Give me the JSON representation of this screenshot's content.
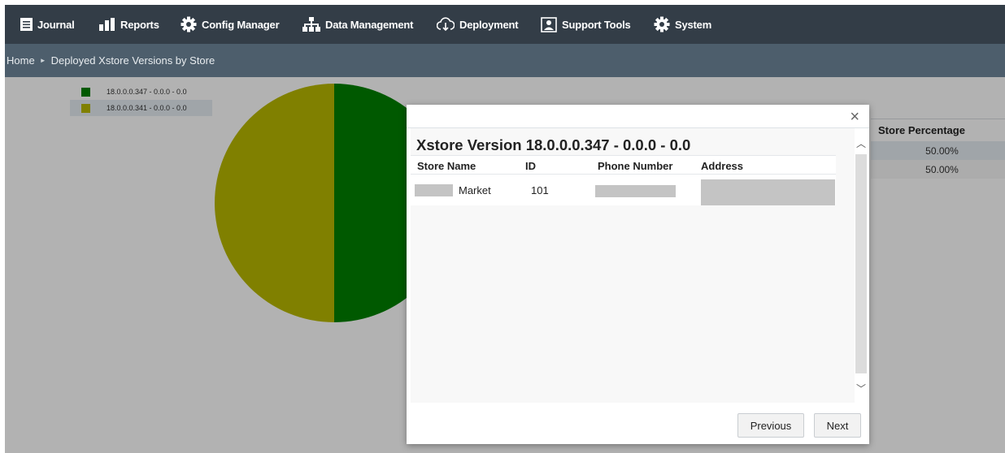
{
  "nav": {
    "items": [
      {
        "label": "Journal",
        "icon": "journal-icon"
      },
      {
        "label": "Reports",
        "icon": "bar-chart-icon"
      },
      {
        "label": "Config Manager",
        "icon": "gear-icon"
      },
      {
        "label": "Data Management",
        "icon": "hierarchy-icon"
      },
      {
        "label": "Deployment",
        "icon": "cloud-download-icon"
      },
      {
        "label": "Support Tools",
        "icon": "support-icon"
      },
      {
        "label": "System",
        "icon": "gear-icon"
      }
    ]
  },
  "breadcrumb": {
    "home": "Home",
    "current": "Deployed Xstore Versions by Store"
  },
  "chart_data": {
    "type": "pie",
    "categories": [
      "18.0.0.0.347 - 0.0.0 - 0.0",
      "18.0.0.0.341 - 0.0.0 - 0.0"
    ],
    "values": [
      50,
      50
    ],
    "colors": [
      "#008000",
      "#b8b800"
    ],
    "legend_position": "top-left"
  },
  "legend": {
    "items": [
      "18.0.0.0.347 - 0.0.0 - 0.0",
      "18.0.0.0.341 - 0.0.0 - 0.0"
    ]
  },
  "percentage_table": {
    "header": "Store Percentage",
    "rows": [
      "50.00%",
      "50.00%"
    ]
  },
  "modal": {
    "close": "×",
    "title": "Xstore Version 18.0.0.0.347 - 0.0.0 - 0.0",
    "columns": [
      "Store Name",
      "ID",
      "Phone Number",
      "Address"
    ],
    "rows": [
      {
        "store_name": "Market",
        "id": "101",
        "phone": "",
        "address": ""
      }
    ],
    "previous_label": "Previous",
    "next_label": "Next"
  }
}
